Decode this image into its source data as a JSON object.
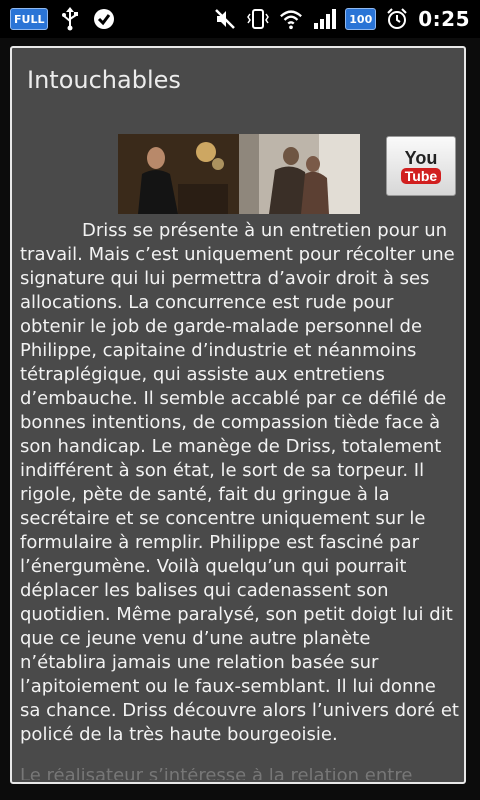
{
  "status_bar": {
    "left_icons": [
      "battery-full-badge-icon",
      "usb-icon",
      "sync-check-icon"
    ],
    "full_badge": "FULL",
    "battery_level": "100",
    "time": "0:25",
    "right_icons": [
      "mute-icon",
      "vibrate-icon",
      "wifi-icon",
      "signal-icon",
      "battery-icon",
      "alarm-icon"
    ]
  },
  "dialog": {
    "title": "Intouchables",
    "youtube": {
      "you": "You",
      "tube": "Tube"
    },
    "synopsis": "Driss se présente à un entretien pour un travail. Mais c’est uniquement pour récolter une signature qui lui permettra d’avoir droit à ses allocations. La concurrence est rude pour obtenir le job de garde-malade personnel de Philippe, capitaine d’industrie et néanmoins tétraplégique, qui assiste aux entretiens d’embauche. Il semble accablé par ce défilé de bonnes intentions, de compassion tiède face à son handicap. Le manège de Driss, totalement indifférent à son état, le sort de sa torpeur. Il rigole, pète de santé, fait du gringue à la secrétaire et se concentre uniquement sur le formulaire à remplir. Philippe est fasciné par l’énergumène. Voilà quelqu’un qui pourrait déplacer les balises qui cadenassent son quotidien. Même paralysé, son petit doigt lui dit que ce jeune venu d’une autre planète n’établira jamais une relation basée sur l’apitoiement ou le faux-semblant. Il lui donne sa chance. Driss découvre alors l’univers doré et policé de la très haute bourgeoisie.",
    "cut_off_line": "Le réalisateur s’intéresse à la relation entre"
  },
  "colors": {
    "dialog_bg": "#4a4a4a",
    "dialog_border": "#e8e8e8",
    "text": "#f2f2f2",
    "statusbar_bg": "#000000",
    "badge_blue": "#2a74d6",
    "youtube_red": "#d11f1f"
  }
}
